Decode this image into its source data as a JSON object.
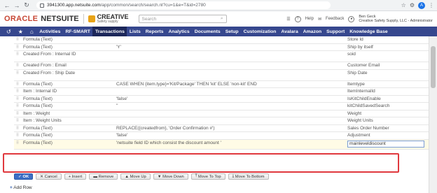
{
  "browser": {
    "url_domain": "3941300.app.netsuite.com",
    "url_path": "/app/common/search/search.nl?cu=1&e=T&id=2780",
    "profile_initial": "A"
  },
  "header": {
    "oracle": "ORACLE",
    "netsuite": "NETSUITE",
    "company_main": "CREATIVE",
    "company_sub": "Safety supply",
    "search_placeholder": "Search",
    "help": "Help",
    "feedback": "Feedback",
    "user_name": "Ben Geck",
    "user_role": "Creative Safety Supply, LLC - Administrator"
  },
  "nav": {
    "items": [
      "Activities",
      "RF-SMART",
      "Transactions",
      "Lists",
      "Reports",
      "Analytics",
      "Documents",
      "Setup",
      "Customization",
      "Avalara",
      "Amazon",
      "Support",
      "Knowledge Base"
    ],
    "active": "Transactions"
  },
  "rows": [
    {
      "c1": "Formula (Text)",
      "c3": "",
      "c4": "Store Id"
    },
    {
      "c1": "Formula (Text)",
      "c3": "'Y'",
      "c4": "Ship by itself"
    },
    {
      "c1": "Created From : Internal ID",
      "c3": "",
      "c4": "soid",
      "tall": true
    },
    {
      "c1": "Created From : Email",
      "c3": "",
      "c4": "Customer Email"
    },
    {
      "c1": "Created From : Ship Date",
      "c3": "",
      "c4": "Ship Date",
      "tall": true
    },
    {
      "c1": "Formula (Text)",
      "c3": "CASE WHEN {item.type}='Kit/Package' THEN 'kit' ELSE 'non-kit' END",
      "c4": "Itemtype"
    },
    {
      "c1": "Item : Internal ID",
      "c3": "",
      "c4": "ItemInternalId"
    },
    {
      "c1": "Formula (Text)",
      "c3": "'false'",
      "c4": "IsKitChildEnable"
    },
    {
      "c1": "Formula (Text)",
      "c3": "''",
      "c4": "kitChildSavedSearch"
    },
    {
      "c1": "Item : Weight",
      "c3": "",
      "c4": "Weight"
    },
    {
      "c1": "Item : Weight Units",
      "c3": "",
      "c4": "Weight Units"
    },
    {
      "c1": "Formula (Text)",
      "c3": "REPLACE({createdfrom}, 'Order Confirmation #')",
      "c4": "Sales Order Number"
    },
    {
      "c1": "Formula (Text)",
      "c3": "'false'",
      "c4": "Adjustment"
    }
  ],
  "edit_row": {
    "c1": "Formula (Text)",
    "c3": "'netsuite field ID which consist the discount amount '",
    "c4": "mainleveldiscount"
  },
  "actions": [
    "OK",
    "Cancel",
    "Insert",
    "Remove",
    "Move Up",
    "Move Down",
    "Move To Top",
    "Move To Bottom"
  ],
  "add_row": "Add Row"
}
